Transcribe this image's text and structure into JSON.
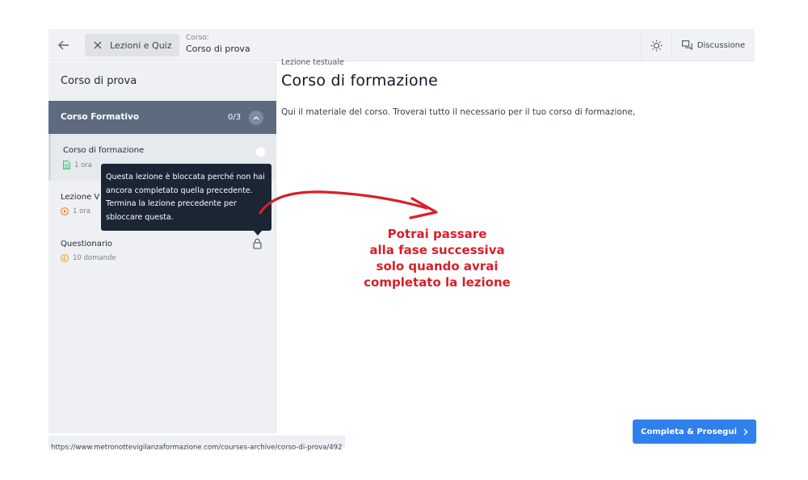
{
  "topbar": {
    "lessons_label": "Lezioni e Quiz",
    "crumb_small": "Corso:",
    "crumb_title": "Corso di prova",
    "discussion_label": "Discussione"
  },
  "sidebar": {
    "title": "Corso di prova",
    "section": {
      "name": "Corso Formativo",
      "count": "0/3"
    },
    "items": [
      {
        "title": "Corso di formazione",
        "meta": "1 ora"
      },
      {
        "title": "Lezione V",
        "meta": "1 ora"
      },
      {
        "title": "Questionario",
        "meta": "10 domande"
      }
    ]
  },
  "tooltip": {
    "text": "Questa lezione è bloccata perché non hai ancora completato quella precedente. Termina la lezione precedente per sbloccare questa."
  },
  "content": {
    "type": "Lezione testuale",
    "title": "Corso di formazione",
    "body": "Qui il materiale del corso. Troverai tutto il necessario per il tuo corso di formazione,"
  },
  "annotation": {
    "lines": [
      "Potrai passare",
      "alla fase successiva",
      "solo quando avrai",
      "completato la lezione"
    ],
    "color": "#d6202b"
  },
  "footer": {
    "complete_label": "Completa & Prosegui",
    "status_url": "https://www.metronottevigilanzaformazione.com/courses-archive/corso-di-prova/492"
  },
  "colors": {
    "accent": "#2f80ed",
    "section_bg": "#5d6b80",
    "tooltip_bg": "#1b2533"
  }
}
